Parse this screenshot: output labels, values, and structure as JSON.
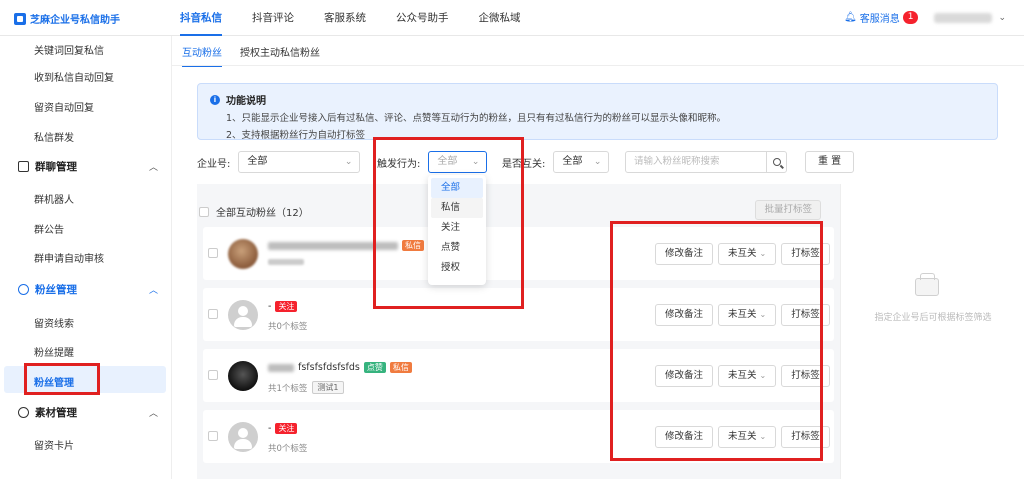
{
  "app": {
    "name": "芝麻企业号私信助手"
  },
  "topnav": [
    {
      "label": "抖音私信",
      "active": true
    },
    {
      "label": "抖音评论",
      "active": false
    },
    {
      "label": "客服系统",
      "active": false
    },
    {
      "label": "公众号助手",
      "active": false
    },
    {
      "label": "企微私域",
      "active": false
    }
  ],
  "topright": {
    "service_label": "客服消息",
    "service_count": "1"
  },
  "sidebar": {
    "items_top": [
      "关键词回复私信",
      "收到私信自动回复",
      "留资自动回复",
      "私信群发"
    ],
    "group_chat": {
      "label": "群聊管理",
      "items": [
        "群机器人",
        "群公告",
        "群申请自动审核"
      ]
    },
    "fans": {
      "label": "粉丝管理",
      "items": [
        "留资线索",
        "粉丝提醒",
        "粉丝管理"
      ]
    },
    "material": {
      "label": "素材管理",
      "items": [
        "留资卡片"
      ]
    }
  },
  "subtabs": [
    "互动粉丝",
    "授权主动私信粉丝"
  ],
  "info": {
    "title": "功能说明",
    "line1": "1、只能显示企业号接入后有过私信、评论、点赞等互动行为的粉丝，且只有有过私信行为的粉丝可以显示头像和昵称。",
    "line2": "2、支持根据粉丝行为自动打标签"
  },
  "filters": {
    "account_label": "企业号:",
    "account_value": "全部",
    "behavior_label": "触发行为:",
    "behavior_value": "全部",
    "mutual_label": "是否互关:",
    "mutual_value": "全部",
    "search_placeholder": "请输入粉丝昵称搜索",
    "reset_label": "重 置"
  },
  "list": {
    "select_all_label": "全部互动粉丝（12）",
    "batch_label": "批量打标签",
    "rows": [
      {
        "name": "",
        "tags": [
          "私信"
        ],
        "sub": ""
      },
      {
        "name": "-",
        "tags": [
          "关注"
        ],
        "sub": "共0个标签"
      },
      {
        "name": "fsfsfsfdsfsfds",
        "tags": [
          "点赞",
          "私信"
        ],
        "sub": "共1个标签",
        "mini_tag": "测试1"
      },
      {
        "name": "-",
        "tags": [
          "关注"
        ],
        "sub": "共0个标签"
      }
    ],
    "action_note": "修改备注",
    "action_mutual": "未互关",
    "action_tag": "打标签"
  },
  "dropdown": {
    "options": [
      "全部",
      "私信",
      "关注",
      "点赞",
      "授权"
    ]
  },
  "right_panel": {
    "empty_text": "指定企业号后可根据标签筛选"
  },
  "colors": {
    "accent": "#1a6fe8",
    "highlight": "#e02020"
  }
}
